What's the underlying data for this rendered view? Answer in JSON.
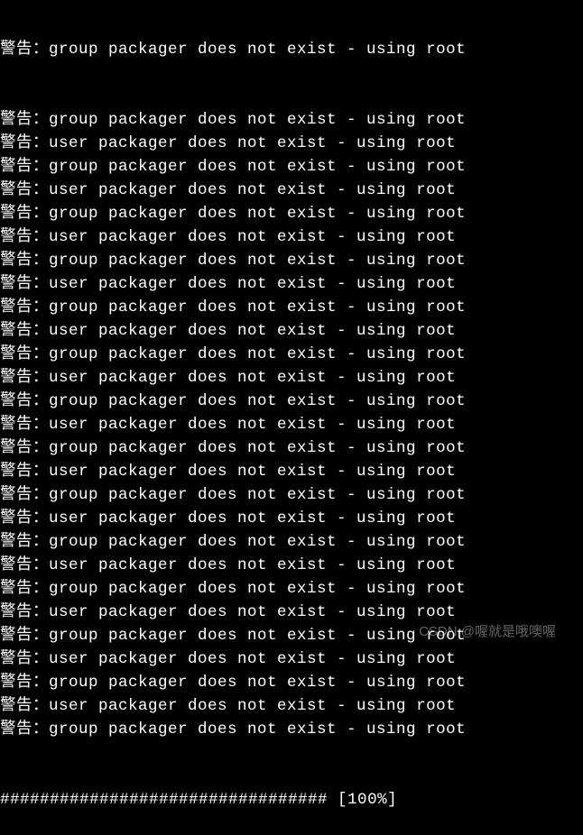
{
  "terminal": {
    "warning_prefix": "警告：",
    "group_msg": "group packager does not exist - using root",
    "user_msg": "user packager does not exist - using root",
    "first_line_partial": "group packager does not exist - using root",
    "lines": [
      "group",
      "user",
      "group",
      "user",
      "group",
      "user",
      "group",
      "user",
      "group",
      "user",
      "group",
      "user",
      "group",
      "user",
      "group",
      "user",
      "group",
      "user",
      "group",
      "user",
      "group",
      "user",
      "group",
      "user",
      "group",
      "user",
      "group"
    ],
    "progress_bar": "################################# [100%]"
  },
  "watermark": "CSDN @喔就是哦噢喔"
}
